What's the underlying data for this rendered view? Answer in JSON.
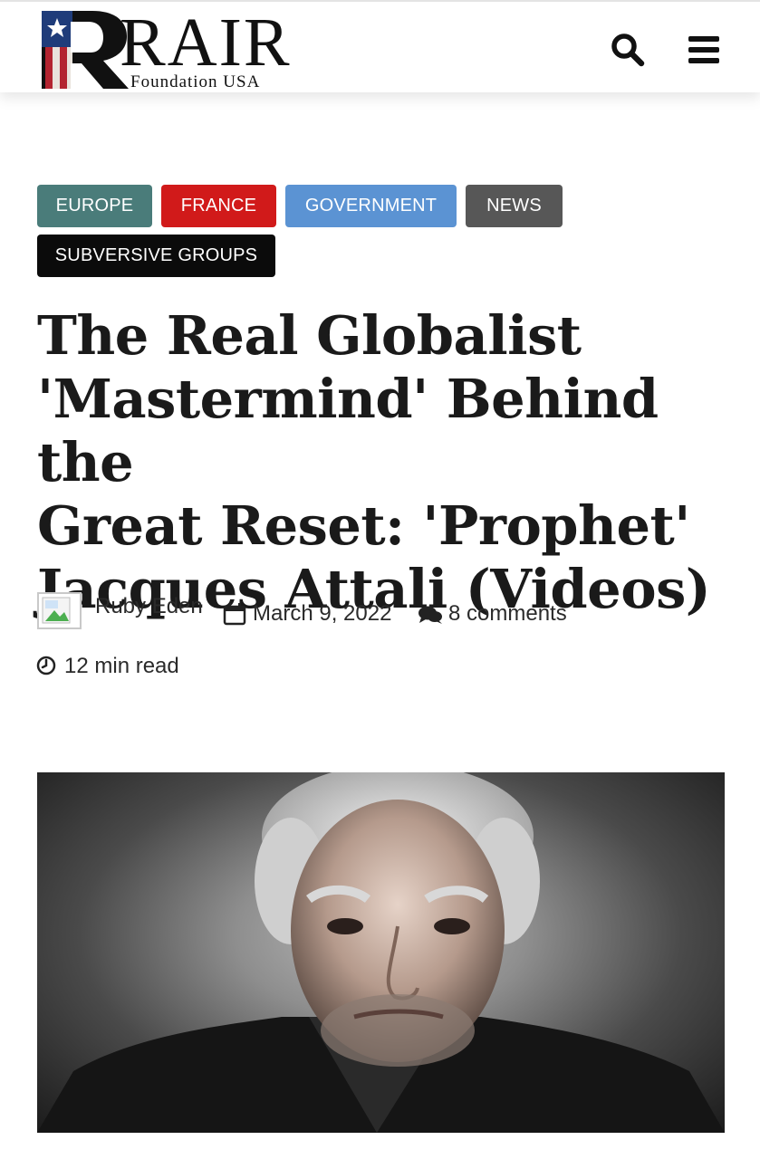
{
  "header": {
    "logo": {
      "wordmark": "RAIR",
      "subtitle": "Foundation USA"
    },
    "search_icon": "search-icon",
    "menu_icon": "hamburger-menu-icon"
  },
  "categories": [
    {
      "label": "EUROPE",
      "color": "#4a7c7a"
    },
    {
      "label": "FRANCE",
      "color": "#d11a1a"
    },
    {
      "label": "GOVERNMENT",
      "color": "#5b93d3"
    },
    {
      "label": "NEWS",
      "color": "#575757"
    },
    {
      "label": "SUBVERSIVE GROUPS",
      "color": "#0b0b0b"
    }
  ],
  "article": {
    "title_lines": [
      "The Real Globalist",
      "'Mastermind' Behind the",
      "Great Reset: 'Prophet'",
      "Jacques Attali (Videos)"
    ],
    "author": "Ruby Eden",
    "date": "March 9, 2022",
    "comments": "8 comments",
    "read_time": "12 min read"
  },
  "featured_image": {
    "icon": "portrait-photo"
  }
}
